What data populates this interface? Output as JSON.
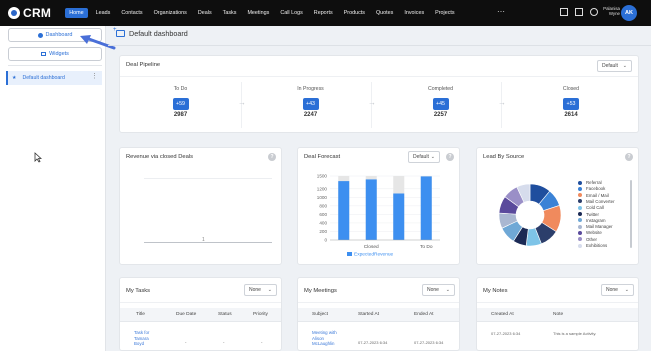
{
  "app": {
    "brand": "CRM",
    "user_name": "Palanisa Wyne",
    "user_initials": "AK"
  },
  "nav": {
    "items": [
      "Home",
      "Leads",
      "Contacts",
      "Organizations",
      "Deals",
      "Tasks",
      "Meetings",
      "Call Logs",
      "Reports",
      "Products",
      "Quotes",
      "Invoices",
      "Projects"
    ],
    "active": "Home",
    "more": "⋯"
  },
  "sidebar": {
    "dashboard_button": "Dashboard",
    "widgets_button": "Widgets",
    "items": [
      {
        "label": "Default dashboard"
      }
    ]
  },
  "main": {
    "title": "Default dashboard"
  },
  "pipeline": {
    "title": "Deal Pipeline",
    "dropdown": "Default",
    "stages": [
      {
        "name": "To Do",
        "badge": "+59",
        "value": "2987"
      },
      {
        "name": "In Progress",
        "badge": "+43",
        "value": "2247"
      },
      {
        "name": "Completed",
        "badge": "+45",
        "value": "2257"
      },
      {
        "name": "Closed",
        "badge": "+53",
        "value": "2614"
      }
    ]
  },
  "revenue": {
    "title": "Revenue via closed Deals",
    "tick": "1"
  },
  "forecast": {
    "title": "Deal Forecast",
    "dropdown": "Default",
    "legend": "ExpectedRevenue",
    "bar_color": "#3d8ff0",
    "bg_color": "#e6e6e6"
  },
  "lead_source": {
    "title": "Lead By Source",
    "items": [
      {
        "label": "Referral",
        "color": "#1f4e9e"
      },
      {
        "label": "Facebook",
        "color": "#3b82d6"
      },
      {
        "label": "Email / Mail",
        "color": "#f08a5d"
      },
      {
        "label": "Mail Converter",
        "color": "#2c3e6b"
      },
      {
        "label": "Cold Call",
        "color": "#7ec4e8"
      },
      {
        "label": "Twitter",
        "color": "#1b2a55"
      },
      {
        "label": "Instagram",
        "color": "#6fa8d6"
      },
      {
        "label": "Mail Manager",
        "color": "#a9b7d1"
      },
      {
        "label": "Website",
        "color": "#5a4a9c"
      },
      {
        "label": "Other",
        "color": "#9a8fc7"
      },
      {
        "label": "Exhibitions",
        "color": "#d6dcec"
      }
    ]
  },
  "chart_data": [
    {
      "type": "bar",
      "title": "Deal Forecast",
      "categories": [
        "Closed",
        "To Do"
      ],
      "x": [
        "",
        "Closed",
        "",
        "To Do"
      ],
      "series": [
        {
          "name": "ExpectedRevenue",
          "values": [
            1380,
            1420,
            1090,
            1490
          ]
        }
      ],
      "ylim": [
        0,
        1500
      ],
      "yticks": [
        "0",
        "200",
        "400",
        "600",
        "800",
        "1000",
        "1200",
        "1500"
      ]
    },
    {
      "type": "pie",
      "title": "Lead By Source",
      "categories": [
        "Referral",
        "Facebook",
        "Email / Mail",
        "Mail Converter",
        "Cold Call",
        "Twitter",
        "Instagram",
        "Mail Manager",
        "Website",
        "Other",
        "Exhibitions"
      ],
      "values": [
        11,
        9,
        14,
        10,
        8,
        7,
        9,
        8,
        9,
        8,
        7
      ]
    }
  ],
  "tasks": {
    "title": "My Tasks",
    "dropdown": "None",
    "columns": [
      "Title",
      "Due Date",
      "Status",
      "Priority"
    ],
    "rows": [
      {
        "title": "Task for Tamara Boyd",
        "due": "-",
        "status": "-",
        "priority": "-"
      }
    ]
  },
  "meetings": {
    "title": "My Meetings",
    "dropdown": "None",
    "columns": [
      "Subject",
      "Started At",
      "Ended At"
    ],
    "rows": [
      {
        "subject": "Meeting with Alison McLaughlin",
        "started": "07-27-2023 6:34",
        "ended": "07-27-2023 6:34"
      }
    ]
  },
  "notes": {
    "title": "My Notes",
    "dropdown": "None",
    "columns": [
      "Created At",
      "Note"
    ],
    "rows": [
      {
        "created": "07-27-2023 6:34",
        "note": "This is a sample Activity."
      }
    ]
  }
}
